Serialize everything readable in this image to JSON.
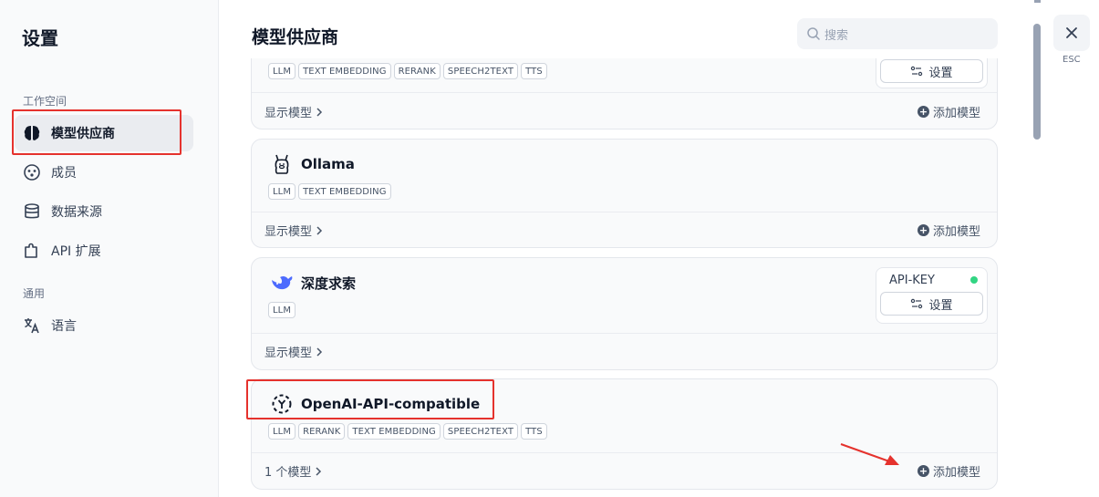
{
  "sidebar": {
    "title": "设置",
    "workspace_label": "工作空间",
    "general_label": "通用",
    "items": [
      {
        "label": "模型供应商",
        "icon": "brain-icon"
      },
      {
        "label": "成员",
        "icon": "members-icon"
      },
      {
        "label": "数据来源",
        "icon": "database-icon"
      },
      {
        "label": "API 扩展",
        "icon": "puzzle-icon"
      }
    ],
    "general_items": [
      {
        "label": "语言",
        "icon": "translate-icon"
      }
    ]
  },
  "header": {
    "title": "模型供应商",
    "search_placeholder": "搜索"
  },
  "providers": [
    {
      "name": "",
      "tags": [
        "LLM",
        "TEXT EMBEDDING",
        "RERANK",
        "SPEECH2TEXT",
        "TTS"
      ],
      "settings_label": "设置",
      "footer_left": "显示模型",
      "footer_right": "添加模型"
    },
    {
      "name": "Ollama",
      "logo": "llama-icon",
      "tags": [
        "LLM",
        "TEXT EMBEDDING"
      ],
      "footer_left": "显示模型",
      "footer_right": "添加模型"
    },
    {
      "name": "深度求索",
      "logo": "whale-icon",
      "tags": [
        "LLM"
      ],
      "apikey_label": "API-KEY",
      "status_color": "#32d583",
      "settings_label": "设置",
      "footer_left": "显示模型"
    },
    {
      "name": "OpenAI-API-compatible",
      "logo": "openai-compatible-icon",
      "tags": [
        "LLM",
        "RERANK",
        "TEXT EMBEDDING",
        "SPEECH2TEXT",
        "TTS"
      ],
      "footer_left": "1 个模型",
      "footer_right": "添加模型"
    }
  ],
  "esc_label": "ESC",
  "colors": {
    "highlight": "#e5322d",
    "status_ok": "#32d583"
  }
}
